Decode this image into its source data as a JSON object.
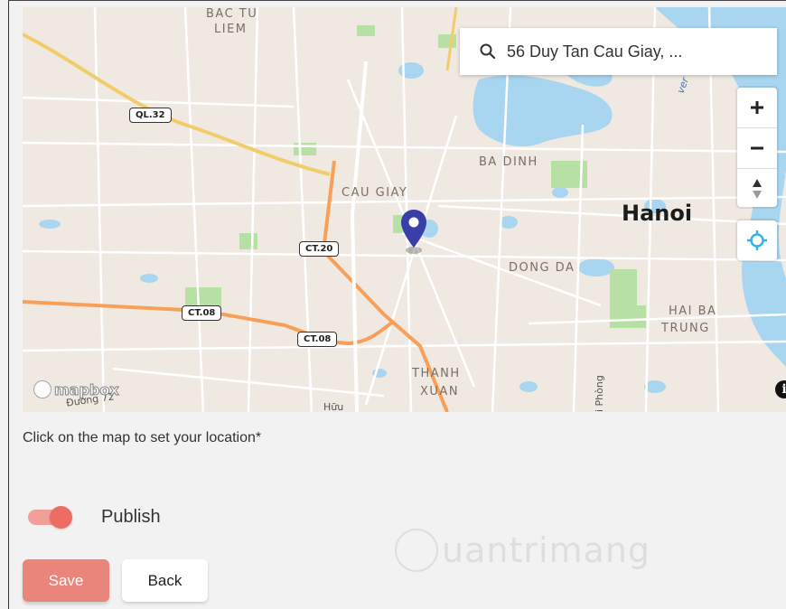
{
  "map": {
    "district_labels": [
      "CAU GIAY",
      "BA DINH",
      "DONG DA",
      "HAI BA",
      "TRUNG",
      "THANH",
      "XUAN",
      "BAC TU",
      "LIEM"
    ],
    "city_label": "Hanoi",
    "road_shields": [
      "QL.32",
      "CT.20",
      "CT.08",
      "CT.08"
    ],
    "street_labels": [
      "Đường 72",
      "Hữu",
      "i Phòng",
      "ver"
    ],
    "attribution_logo": "mapbox",
    "info_label": "i",
    "search": {
      "value": "56 Duy Tan Cau Giay, ...",
      "icon": "search-icon"
    },
    "controls": {
      "zoom_in": "+",
      "zoom_out": "−",
      "compass": "compass-icon",
      "geolocate": "geolocate-icon"
    },
    "colors": {
      "water": "#a8d5ef",
      "land": "#f0ebe3",
      "park": "#b7e0a4",
      "highway": "#f8a059",
      "primary_road": "#f1cd6a",
      "marker": "#3a3ea8"
    }
  },
  "form": {
    "hint": "Click on the map to set your location*",
    "publish_label": "Publish",
    "publish_enabled": true,
    "save_label": "Save",
    "back_label": "Back"
  },
  "watermark": {
    "text": "uantrimang"
  }
}
